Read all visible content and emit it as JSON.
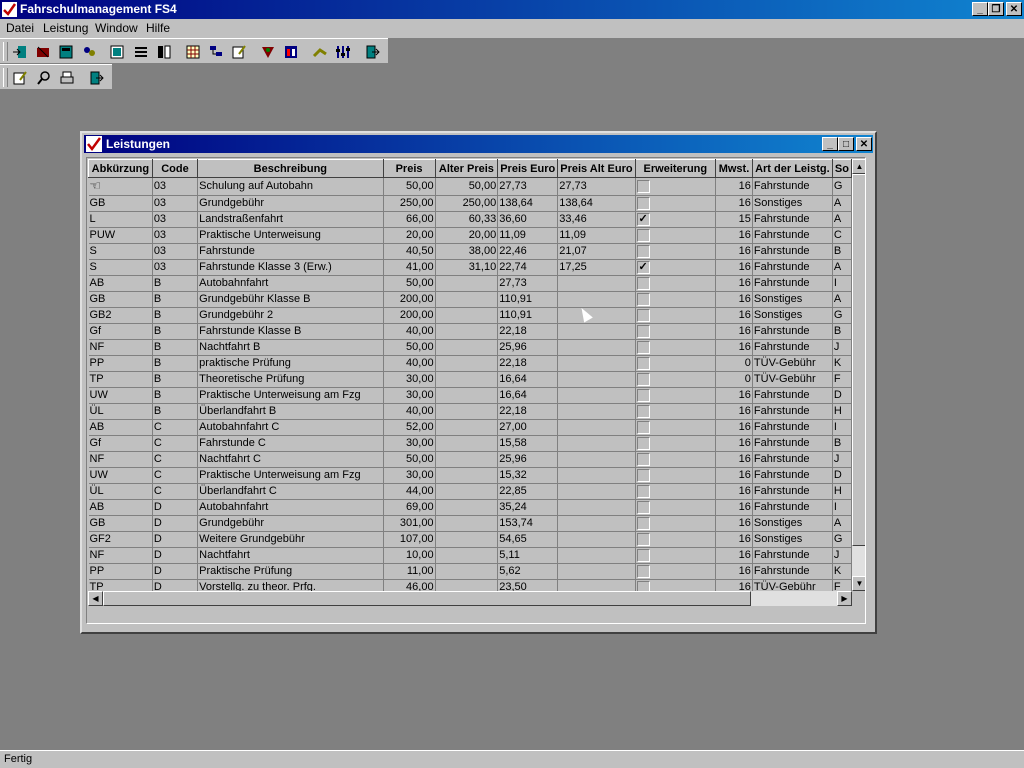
{
  "app": {
    "title": "Fahrschulmanagement FS4",
    "status": "Fertig"
  },
  "menu": [
    "Datei",
    "Leistung",
    "Window",
    "Hilfe"
  ],
  "child": {
    "title": "Leistungen"
  },
  "grid": {
    "columns": [
      "Abkürzung",
      "Code",
      "Beschreibung",
      "Preis",
      "Alter Preis",
      "Preis Euro",
      "Preis Alt Euro",
      "Erweiterung",
      "Mwst.",
      "Art der Leistg.",
      "So"
    ],
    "rows": [
      {
        "abk": "",
        "code": "03",
        "desc": "Schulung auf Autobahn",
        "preis": "50,00",
        "alt": "50,00",
        "euro": "27,73",
        "alteuro": "27,73",
        "erw": false,
        "mwst": "16",
        "art": "Fahrstunde",
        "so": "G"
      },
      {
        "abk": "GB",
        "code": "03",
        "desc": "Grundgebühr",
        "preis": "250,00",
        "alt": "250,00",
        "euro": "138,64",
        "alteuro": "138,64",
        "erw": false,
        "mwst": "16",
        "art": "Sonstiges",
        "so": "A"
      },
      {
        "abk": "L",
        "code": "03",
        "desc": "Landstraßenfahrt",
        "preis": "66,00",
        "alt": "60,33",
        "euro": "36,60",
        "alteuro": "33,46",
        "erw": true,
        "mwst": "15",
        "art": "Fahrstunde",
        "so": "A"
      },
      {
        "abk": "PUW",
        "code": "03",
        "desc": "Praktische Unterweisung",
        "preis": "20,00",
        "alt": "20,00",
        "euro": "11,09",
        "alteuro": "11,09",
        "erw": false,
        "mwst": "16",
        "art": "Fahrstunde",
        "so": "C"
      },
      {
        "abk": "S",
        "code": "03",
        "desc": "Fahrstunde",
        "preis": "40,50",
        "alt": "38,00",
        "euro": "22,46",
        "alteuro": "21,07",
        "erw": false,
        "mwst": "16",
        "art": "Fahrstunde",
        "so": "B"
      },
      {
        "abk": "S",
        "code": "03",
        "desc": "Fahrstunde Klasse 3 (Erw.)",
        "preis": "41,00",
        "alt": "31,10",
        "euro": "22,74",
        "alteuro": "17,25",
        "erw": true,
        "mwst": "16",
        "art": "Fahrstunde",
        "so": "A"
      },
      {
        "abk": "AB",
        "code": "B",
        "desc": "Autobahnfahrt",
        "preis": "50,00",
        "alt": "",
        "euro": "27,73",
        "alteuro": "",
        "erw": false,
        "mwst": "16",
        "art": "Fahrstunde",
        "so": "I"
      },
      {
        "abk": "GB",
        "code": "B",
        "desc": "Grundgebühr Klasse B",
        "preis": "200,00",
        "alt": "",
        "euro": "110,91",
        "alteuro": "",
        "erw": false,
        "mwst": "16",
        "art": "Sonstiges",
        "so": "A"
      },
      {
        "abk": "GB2",
        "code": "B",
        "desc": "Grundgebühr 2",
        "preis": "200,00",
        "alt": "",
        "euro": "110,91",
        "alteuro": "",
        "erw": false,
        "mwst": "16",
        "art": "Sonstiges",
        "so": "G"
      },
      {
        "abk": "Gf",
        "code": "B",
        "desc": "Fahrstunde Klasse B",
        "preis": "40,00",
        "alt": "",
        "euro": "22,18",
        "alteuro": "",
        "erw": false,
        "mwst": "16",
        "art": "Fahrstunde",
        "so": "B"
      },
      {
        "abk": "NF",
        "code": "B",
        "desc": "Nachtfahrt B",
        "preis": "50,00",
        "alt": "",
        "euro": "25,96",
        "alteuro": "",
        "erw": false,
        "mwst": "16",
        "art": "Fahrstunde",
        "so": "J"
      },
      {
        "abk": "PP",
        "code": "B",
        "desc": "praktische Prüfung",
        "preis": "40,00",
        "alt": "",
        "euro": "22,18",
        "alteuro": "",
        "erw": false,
        "mwst": "0",
        "art": "TÜV-Gebühr",
        "so": "K"
      },
      {
        "abk": "TP",
        "code": "B",
        "desc": "Theoretische Prüfung",
        "preis": "30,00",
        "alt": "",
        "euro": "16,64",
        "alteuro": "",
        "erw": false,
        "mwst": "0",
        "art": "TÜV-Gebühr",
        "so": "F"
      },
      {
        "abk": "UW",
        "code": "B",
        "desc": "Praktische Unterweisung am Fzg",
        "preis": "30,00",
        "alt": "",
        "euro": "16,64",
        "alteuro": "",
        "erw": false,
        "mwst": "16",
        "art": "Fahrstunde",
        "so": "D"
      },
      {
        "abk": "ÜL",
        "code": "B",
        "desc": "Überlandfahrt B",
        "preis": "40,00",
        "alt": "",
        "euro": "22,18",
        "alteuro": "",
        "erw": false,
        "mwst": "16",
        "art": "Fahrstunde",
        "so": "H"
      },
      {
        "abk": "AB",
        "code": "C",
        "desc": "Autobahnfahrt C",
        "preis": "52,00",
        "alt": "",
        "euro": "27,00",
        "alteuro": "",
        "erw": false,
        "mwst": "16",
        "art": "Fahrstunde",
        "so": "I"
      },
      {
        "abk": "Gf",
        "code": "C",
        "desc": "Fahrstunde C",
        "preis": "30,00",
        "alt": "",
        "euro": "15,58",
        "alteuro": "",
        "erw": false,
        "mwst": "16",
        "art": "Fahrstunde",
        "so": "B"
      },
      {
        "abk": "NF",
        "code": "C",
        "desc": "Nachtfahrt C",
        "preis": "50,00",
        "alt": "",
        "euro": "25,96",
        "alteuro": "",
        "erw": false,
        "mwst": "16",
        "art": "Fahrstunde",
        "so": "J"
      },
      {
        "abk": "UW",
        "code": "C",
        "desc": "Praktische Unterweisung am Fzg",
        "preis": "30,00",
        "alt": "",
        "euro": "15,32",
        "alteuro": "",
        "erw": false,
        "mwst": "16",
        "art": "Fahrstunde",
        "so": "D"
      },
      {
        "abk": "ÜL",
        "code": "C",
        "desc": "Überlandfahrt C",
        "preis": "44,00",
        "alt": "",
        "euro": "22,85",
        "alteuro": "",
        "erw": false,
        "mwst": "16",
        "art": "Fahrstunde",
        "so": "H"
      },
      {
        "abk": "AB",
        "code": "D",
        "desc": "Autobahnfahrt",
        "preis": "69,00",
        "alt": "",
        "euro": "35,24",
        "alteuro": "",
        "erw": false,
        "mwst": "16",
        "art": "Fahrstunde",
        "so": "I"
      },
      {
        "abk": "GB",
        "code": "D",
        "desc": "Grundgebühr",
        "preis": "301,00",
        "alt": "",
        "euro": "153,74",
        "alteuro": "",
        "erw": false,
        "mwst": "16",
        "art": "Sonstiges",
        "so": "A"
      },
      {
        "abk": "GF2",
        "code": "D",
        "desc": "Weitere Grundgebühr",
        "preis": "107,00",
        "alt": "",
        "euro": "54,65",
        "alteuro": "",
        "erw": false,
        "mwst": "16",
        "art": "Sonstiges",
        "so": "G"
      },
      {
        "abk": "NF",
        "code": "D",
        "desc": "Nachtfahrt",
        "preis": "10,00",
        "alt": "",
        "euro": "5,11",
        "alteuro": "",
        "erw": false,
        "mwst": "16",
        "art": "Fahrstunde",
        "so": "J"
      },
      {
        "abk": "PP",
        "code": "D",
        "desc": "Praktische Prüfung",
        "preis": "11,00",
        "alt": "",
        "euro": "5,62",
        "alteuro": "",
        "erw": false,
        "mwst": "16",
        "art": "Fahrstunde",
        "so": "K"
      },
      {
        "abk": "TP",
        "code": "D",
        "desc": "Vorstellg. zu theor. Prfg.",
        "preis": "46,00",
        "alt": "",
        "euro": "23,50",
        "alteuro": "",
        "erw": false,
        "mwst": "16",
        "art": "TÜV-Gebühr",
        "so": "F"
      }
    ]
  },
  "toolbar1_icons": [
    "login-icon",
    "edit-student-icon",
    "calculator-icon",
    "users-icon",
    "report-icon",
    "list-icon",
    "columns-icon",
    "table-icon",
    "tree-icon",
    "edit-icon",
    "badge-icon",
    "calendar-icon",
    "printer-hand-icon",
    "settings-icon",
    "exit-icon"
  ],
  "toolbar2_icons": [
    "edit-icon",
    "search-icon",
    "printer-icon",
    "exit-icon"
  ]
}
